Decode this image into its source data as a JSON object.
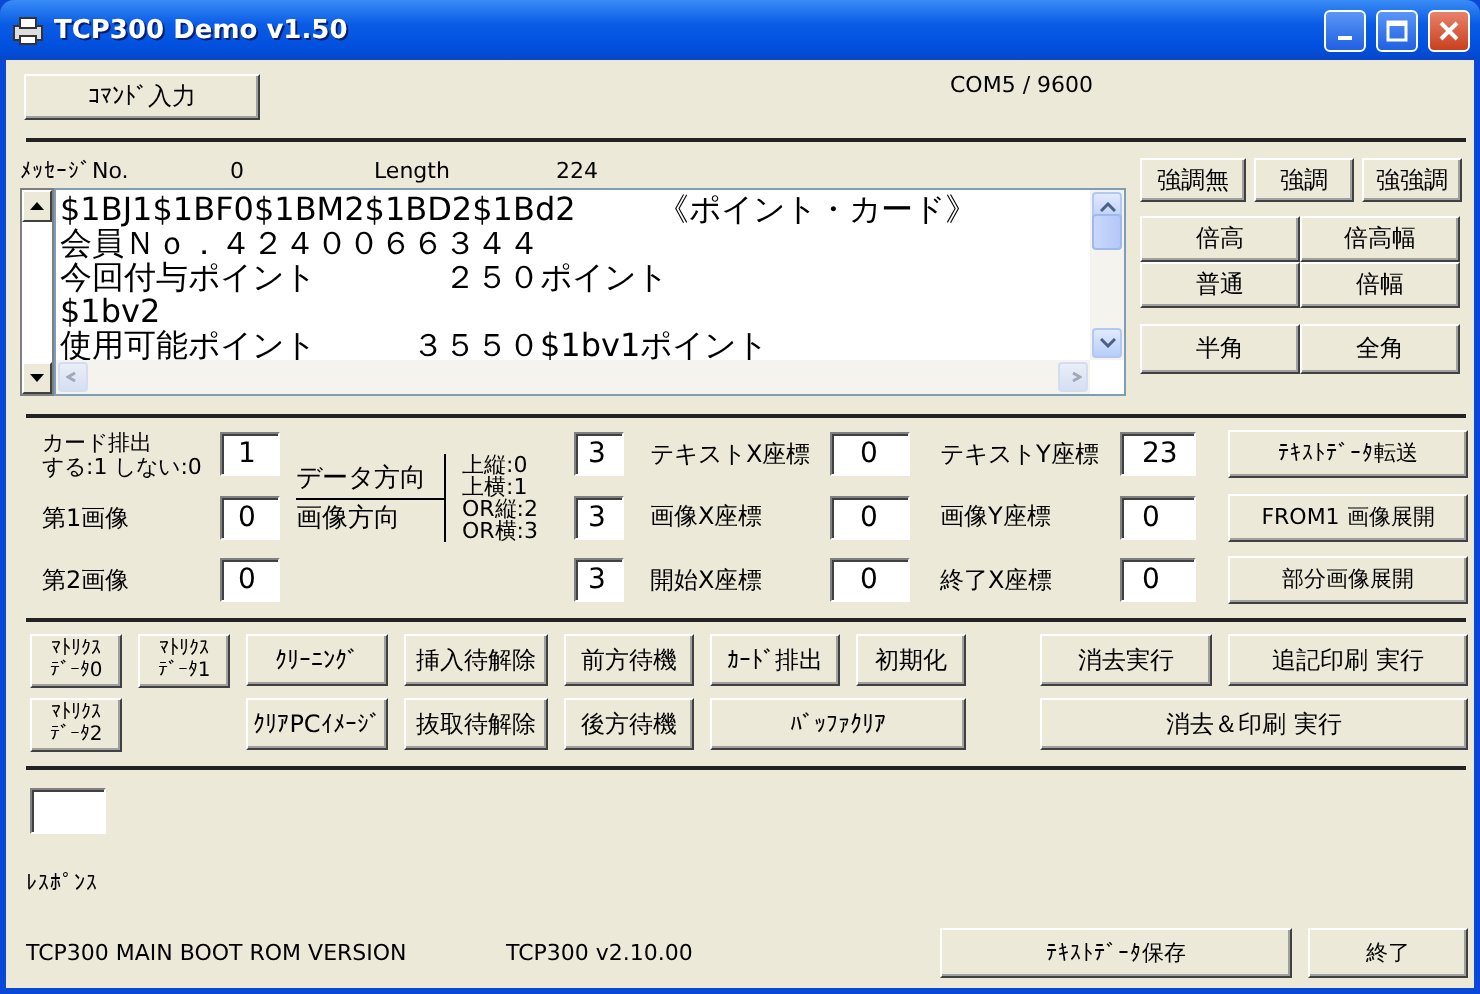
{
  "window": {
    "title": "TCP300 Demo v1.50"
  },
  "command_button": "ｺﾏﾝﾄﾞ入力",
  "port": "COM5 / 9600",
  "message": {
    "no_label": "ﾒｯｾｰｼﾞNo.",
    "no": "0",
    "length_label": "Length",
    "length": "224"
  },
  "message_text": [
    "$1BJ1$1BF0$1BM2$1BD2$1Bd2        《ポイント・カード》",
    "会員Ｎｏ．４２４００６６３４４",
    "今回付与ポイント　　　　２５０ポイント",
    "$1bv2",
    "使用可能ポイント　　　３５５０$1bv1ポイント"
  ],
  "style_buttons": [
    "強調無",
    "強調",
    "強強調"
  ],
  "size_buttons": [
    "倍高",
    "倍高幅",
    "普通",
    "倍幅"
  ],
  "width_buttons": [
    "半角",
    "全角"
  ],
  "left_fields": [
    {
      "label": "カード排出",
      "hint": "する:1 しない:0",
      "value": "1"
    },
    {
      "label": "第1画像",
      "value": "0"
    },
    {
      "label": "第2画像",
      "value": "0"
    }
  ],
  "direction": {
    "labels": [
      "データ方向",
      "画像方向"
    ],
    "options": [
      "上縦:0",
      "上横:1",
      "OR縦:2",
      "OR横:3"
    ],
    "values": [
      "3",
      "3",
      "3"
    ]
  },
  "x_fields": [
    {
      "label": "テキストX座標",
      "value": "0"
    },
    {
      "label": "画像X座標",
      "value": "0"
    },
    {
      "label": "開始X座標",
      "value": "0"
    }
  ],
  "y_fields": [
    {
      "label": "テキストY座標",
      "value": "23"
    },
    {
      "label": "画像Y座標",
      "value": "0"
    },
    {
      "label": "終了X座標",
      "value": "0"
    }
  ],
  "side_buttons": [
    "ﾃｷｽﾄﾃﾞｰﾀ転送",
    "FROM1 画像展開",
    "部分画像展開"
  ],
  "action_buttons": [
    "ﾏﾄﾘｸｽﾃﾞｰﾀ0",
    "ﾏﾄﾘｸｽﾃﾞｰﾀ1",
    "ｸﾘｰﾆﾝｸﾞ",
    "挿入待解除",
    "前方待機",
    "ｶｰﾄﾞ排出",
    "初期化",
    "消去実行",
    "追記印刷 実行",
    "ﾏﾄﾘｸｽﾃﾞｰﾀ2",
    "ｸﾘｱPCｲﾒｰｼﾞ",
    "抜取待解除",
    "後方待機",
    "ﾊﾞｯﾌｧｸﾘｱ",
    "消去＆印刷 実行"
  ],
  "response_label": "ﾚｽﾎﾟﾝｽ",
  "footer": {
    "version_label": "TCP300 MAIN BOOT ROM VERSION",
    "version": "TCP300 v2.10.00",
    "buttons": [
      "ﾃｷｽﾄﾃﾞｰﾀ保存",
      "終了"
    ]
  }
}
